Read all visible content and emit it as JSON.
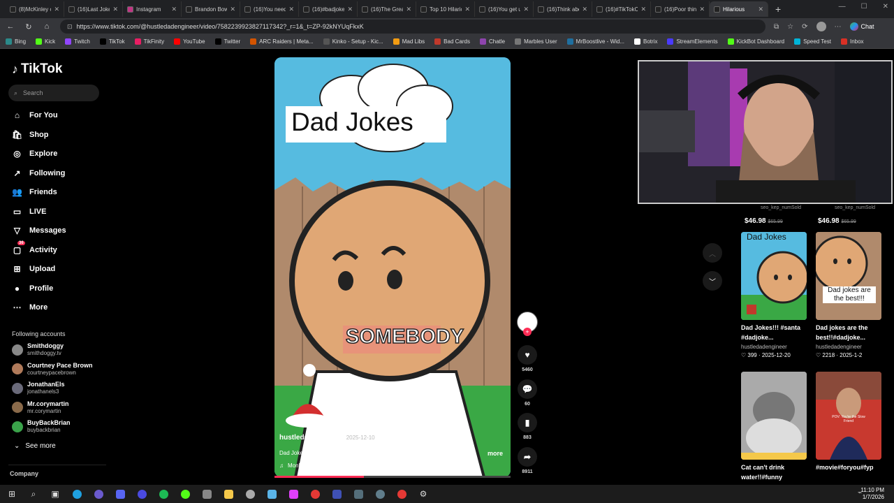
{
  "browser": {
    "tabs": [
      {
        "label": "(8)McKinley on",
        "color": "#222"
      },
      {
        "label": "(16)Last Joke O",
        "color": "#222"
      },
      {
        "label": "Instagram",
        "color": "#c13584"
      },
      {
        "label": "Brandon Bowe",
        "color": "#222"
      },
      {
        "label": "(16)You need to",
        "color": "#222"
      },
      {
        "label": "(16)#badjoke",
        "color": "#222"
      },
      {
        "label": "(16)The Great",
        "color": "#222"
      },
      {
        "label": "Top 10 Hilario",
        "color": "#222"
      },
      {
        "label": "(16)You get us",
        "color": "#222"
      },
      {
        "label": "(16)Think abo",
        "color": "#222"
      },
      {
        "label": "(16)#TikTokCr",
        "color": "#222"
      },
      {
        "label": "(16)Poor thing",
        "color": "#222"
      },
      {
        "label": "Hilarious",
        "color": "#222"
      }
    ],
    "url": "https://www.tiktok.com/@hustledadengineer/video/7582239923827117342?_r=1&_t=ZP-92kNYUqFkxK",
    "chat_label": "Chat",
    "bookmarks": [
      {
        "label": "Bing",
        "color": "#2b8a8a"
      },
      {
        "label": "Kick",
        "color": "#53fc18"
      },
      {
        "label": "Twitch",
        "color": "#9146ff"
      },
      {
        "label": "TikTok",
        "color": "#000"
      },
      {
        "label": "TikFinity",
        "color": "#e91e63"
      },
      {
        "label": "YouTube",
        "color": "#ff0000"
      },
      {
        "label": "Twitter",
        "color": "#000"
      },
      {
        "label": "ARC Raiders | Meta...",
        "color": "#d35400"
      },
      {
        "label": "Kinko - Setup - Kic...",
        "color": "#555"
      },
      {
        "label": "Mad Libs",
        "color": "#f39c12"
      },
      {
        "label": "Bad Cards",
        "color": "#c0392b"
      },
      {
        "label": "Chatle",
        "color": "#8e44ad"
      },
      {
        "label": "Marbles User",
        "color": "#777"
      },
      {
        "label": "MrBoostlive - Wid...",
        "color": "#1f6f9f"
      },
      {
        "label": "Botrix",
        "color": "#fff"
      },
      {
        "label": "StreamElements",
        "color": "#4a3aff"
      },
      {
        "label": "KickBot Dashboard",
        "color": "#53fc18"
      },
      {
        "label": "Speed Test",
        "color": "#00b4d8"
      },
      {
        "label": "Inbox",
        "color": "#d93025"
      }
    ]
  },
  "sidebar": {
    "logo": "TikTok",
    "search_placeholder": "Search",
    "nav": [
      {
        "label": "For You",
        "icon": "home-icon",
        "glyph": "⌂"
      },
      {
        "label": "Shop",
        "icon": "shop-icon",
        "glyph": "🛍"
      },
      {
        "label": "Explore",
        "icon": "explore-icon",
        "glyph": "◎"
      },
      {
        "label": "Following",
        "icon": "following-icon",
        "glyph": "↗"
      },
      {
        "label": "Friends",
        "icon": "friends-icon",
        "glyph": "👥"
      },
      {
        "label": "LIVE",
        "icon": "live-icon",
        "glyph": "▭"
      },
      {
        "label": "Messages",
        "icon": "messages-icon",
        "glyph": "▽"
      },
      {
        "label": "Activity",
        "icon": "activity-icon",
        "glyph": "▢"
      },
      {
        "label": "Upload",
        "icon": "upload-icon",
        "glyph": "⊞"
      },
      {
        "label": "Profile",
        "icon": "profile-icon",
        "glyph": "●"
      },
      {
        "label": "More",
        "icon": "more-icon",
        "glyph": "⋯"
      }
    ],
    "activity_badge": "36",
    "following_header": "Following accounts",
    "accounts": [
      {
        "name": "Smithdoggy",
        "handle": "smithdoggy.tv",
        "color": "#888"
      },
      {
        "name": "Courtney Pace Brown",
        "handle": "courtneypacebrown",
        "color": "#b07a5a"
      },
      {
        "name": "JonathanEls",
        "handle": "jonathanels3",
        "color": "#6a6a7a"
      },
      {
        "name": "Mr.corymartin",
        "handle": "mr.corymartin",
        "color": "#8a6a4a"
      },
      {
        "name": "BuyBackBrian",
        "handle": "buybackbrian",
        "color": "#3aa24a"
      }
    ],
    "see_more": "See more",
    "company": "Company"
  },
  "video": {
    "title_cloud": "Dad Jokes",
    "caption_word": "SOMEBODY",
    "author": "hustledadengineer",
    "date": "2025-12-10",
    "description": "Dad Jokes!!!  Don't miss out on the perfect gift for dad!!!",
    "more": "more",
    "music": "Monkeys Spinning Monkeys - Kevin MacLeod & Kevin The Monkey",
    "progress": 0.38
  },
  "actions": {
    "likes": "5460",
    "comments": "60",
    "saves": "883",
    "shares": "8911"
  },
  "results": {
    "seo_label_1": "seo_kep_numSold",
    "seo_label_2": "seo_kep_numSold",
    "price_1": "$46.98",
    "old_price_1": "$65.99",
    "price_2": "$46.98",
    "old_price_2": "$65.99",
    "cards": [
      {
        "title": "Dad Jokes!!! #santa #dadjoke...",
        "user": "hustledadengineer",
        "stats": "♡ 399 · 2025-12-20",
        "overlay": "Dad Jokes"
      },
      {
        "title": "Dad jokes are the best!!#dadjoke...",
        "user": "hustledadengineer",
        "stats": "♡ 2218 · 2025-1-2",
        "overlay": "Dad jokes are the best!!!"
      },
      {
        "title": "Cat can't drink water!!#funny",
        "user": "",
        "stats": "",
        "overlay": ""
      },
      {
        "title": "#movie#foryou#fyp",
        "user": "",
        "stats": "",
        "overlay": "POV: You're the Slow Friend"
      }
    ]
  },
  "taskbar": {
    "time": "11:10 PM",
    "date": "1/7/2026"
  }
}
